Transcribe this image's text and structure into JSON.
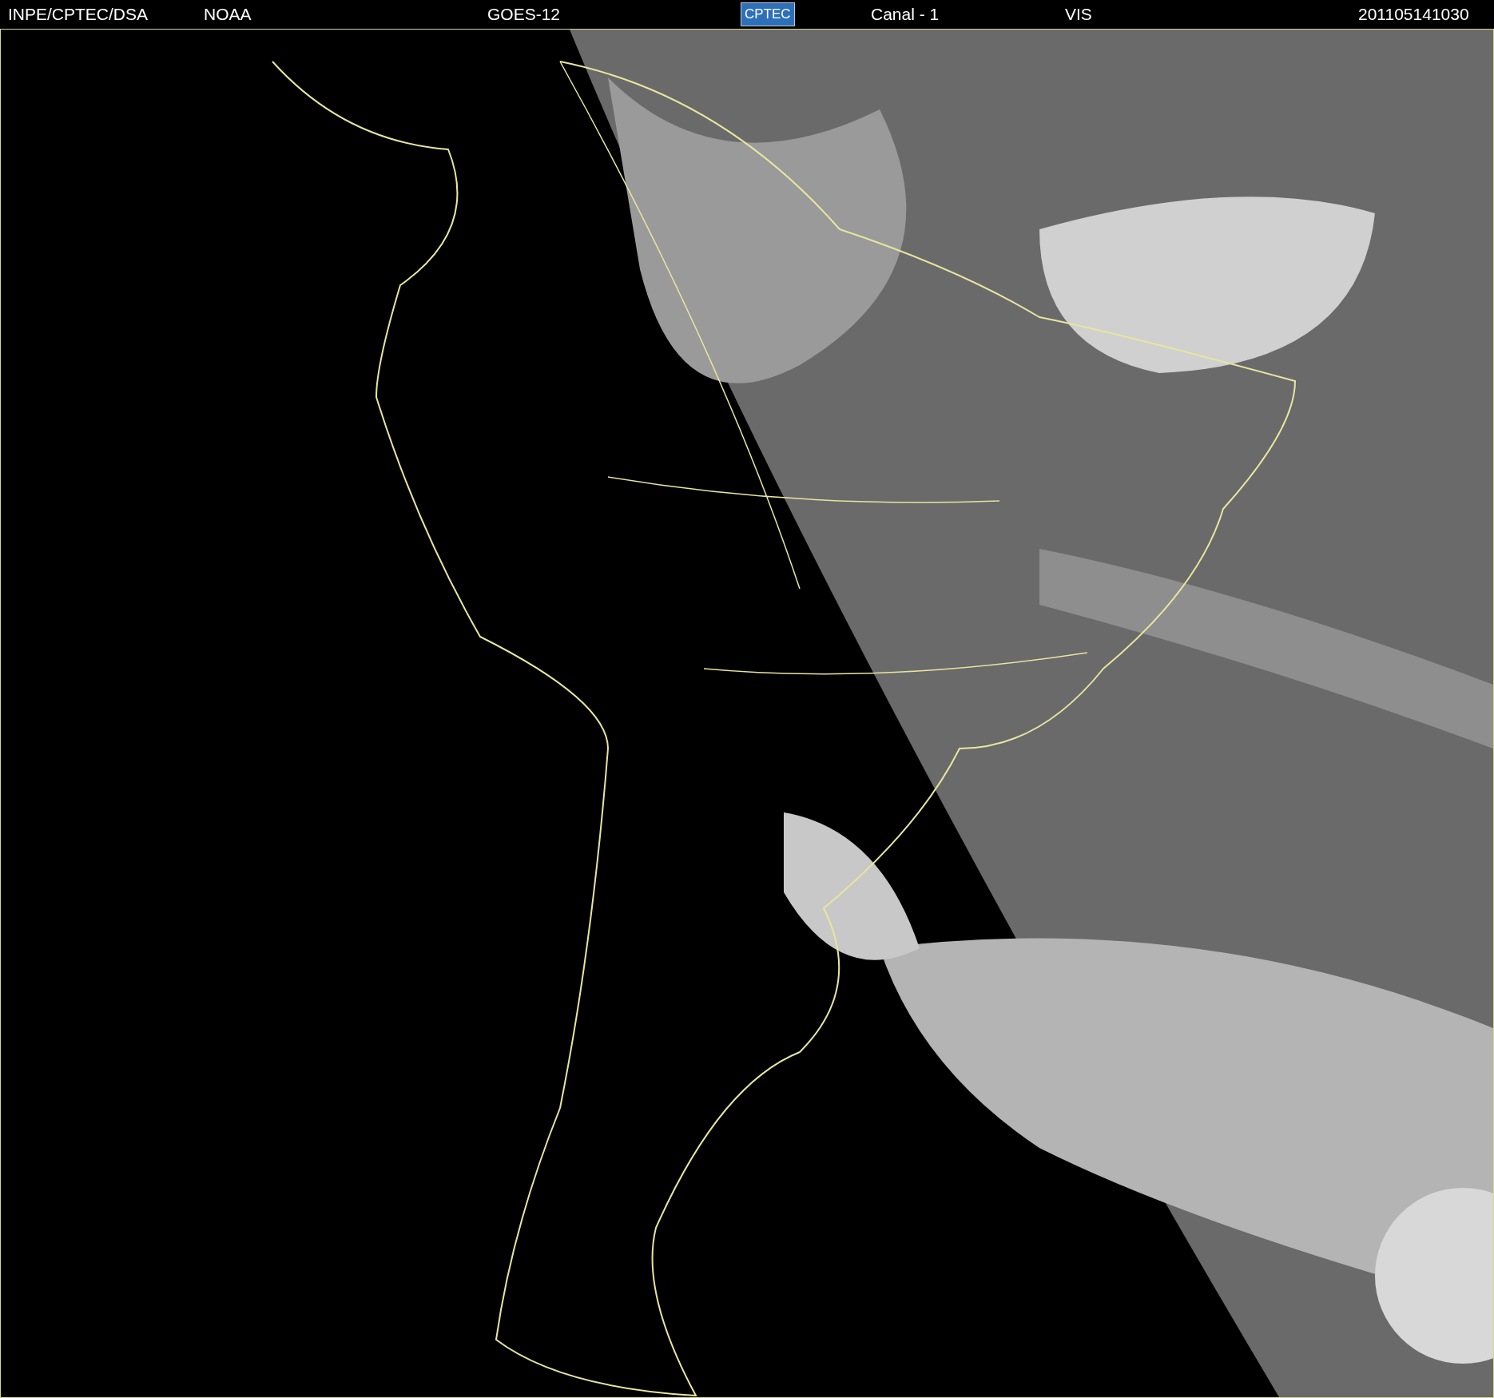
{
  "header": {
    "source": "INPE/CPTEC/DSA",
    "agency": "NOAA",
    "satellite": "GOES-12",
    "logo": "CPTEC",
    "channel": "Canal - 1",
    "band": "VIS",
    "timestamp": "201105141030"
  }
}
